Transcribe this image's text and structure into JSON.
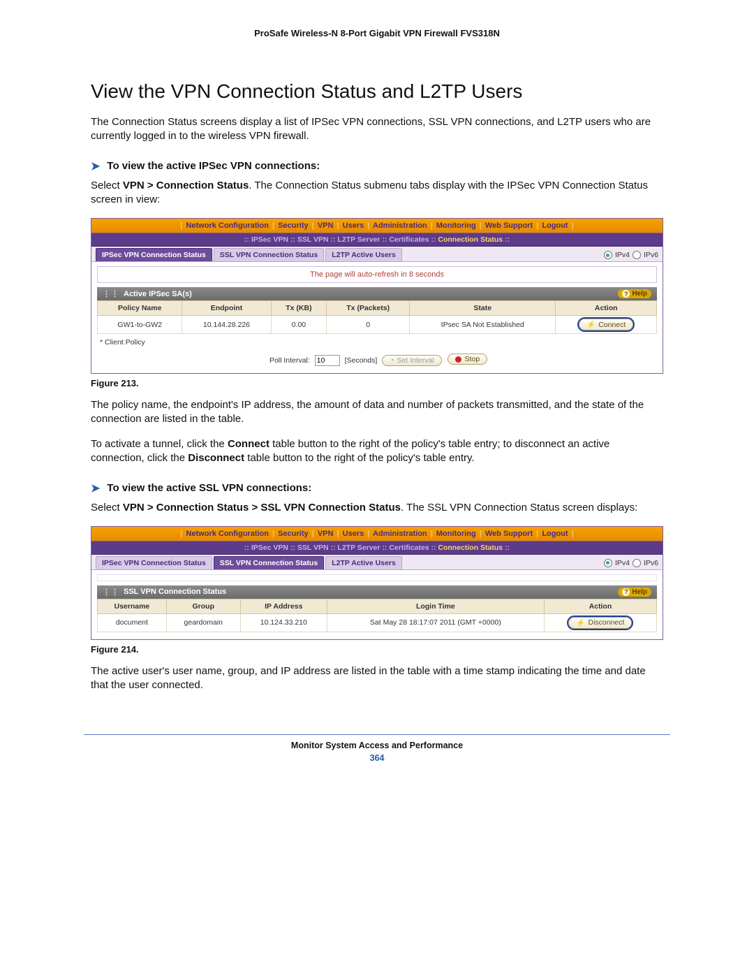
{
  "doc_header": "ProSafe Wireless-N 8-Port Gigabit VPN Firewall FVS318N",
  "section_title": "View the VPN Connection Status and L2TP Users",
  "intro": "The Connection Status screens display a list of IPSec VPN connections, SSL VPN connections, and L2TP users who are currently logged in to the wireless VPN firewall.",
  "ipsec": {
    "heading": "To view the active IPSec VPN connections:",
    "para_before": "Select ",
    "para_bold": "VPN > Connection Status",
    "para_after": ". The Connection Status submenu tabs display with the IPSec VPN Connection Status screen in view:",
    "caption": "Figure 213.",
    "desc1": "The policy name, the endpoint's IP address, the amount of data and number of packets transmitted, and the state of the connection are listed in the table.",
    "desc2_a": "To activate a tunnel, click the ",
    "desc2_b": "Connect",
    "desc2_c": " table button to the right of the policy's table entry; to disconnect an active connection, click the ",
    "desc2_d": "Disconnect",
    "desc2_e": " table button to the right of the policy's table entry."
  },
  "ssl": {
    "heading": "To view the active SSL VPN connections:",
    "para_before": "Select ",
    "para_bold": "VPN > Connection Status > SSL VPN Connection Status",
    "para_after": ". The SSL VPN Connection Status screen displays:",
    "caption": "Figure 214.",
    "desc": "The active user's user name, group, and IP address are listed in the table with a time stamp indicating the time and date that the user connected."
  },
  "topnav": {
    "items": [
      "Network Configuration",
      "Security",
      "VPN",
      "Users",
      "Administration",
      "Monitoring",
      "Web Support",
      "Logout"
    ]
  },
  "subnav": {
    "items": [
      "IPSec VPN",
      "SSL VPN",
      "L2TP Server",
      "Certificates",
      "Connection Status"
    ]
  },
  "tabs": {
    "ipsec": "IPSec VPN Connection Status",
    "ssl": "SSL VPN Connection Status",
    "l2tp": "L2TP Active Users"
  },
  "ip_toggle": {
    "ipv4": "IPv4",
    "ipv6": "IPv6"
  },
  "shot1": {
    "refresh": "The page will auto-refresh in 8 seconds",
    "panel_title": "Active IPSec SA(s)",
    "help": "Help",
    "cols": [
      "Policy Name",
      "Endpoint",
      "Tx (KB)",
      "Tx (Packets)",
      "State",
      "Action"
    ],
    "row": {
      "policy": "GW1-to-GW2",
      "endpoint": "10.144.28.226",
      "txkb": "0.00",
      "txpk": "0",
      "state": "IPsec SA Not Established",
      "action": "Connect"
    },
    "client_policy": "* Client Policy",
    "poll_label": "Poll Interval:",
    "poll_value": "10",
    "seconds": "[Seconds]",
    "set_interval": "Set Interval",
    "stop": "Stop"
  },
  "shot2": {
    "panel_title": "SSL VPN Connection Status",
    "help": "Help",
    "cols": [
      "Username",
      "Group",
      "IP Address",
      "Login Time",
      "Action"
    ],
    "row": {
      "user": "document",
      "group": "geardomain",
      "ip": "10.124.33.210",
      "login": "Sat May 28 18:17:07 2011 (GMT +0000)",
      "action": "Disconnect"
    }
  },
  "footer": {
    "title": "Monitor System Access and Performance",
    "page": "364"
  }
}
